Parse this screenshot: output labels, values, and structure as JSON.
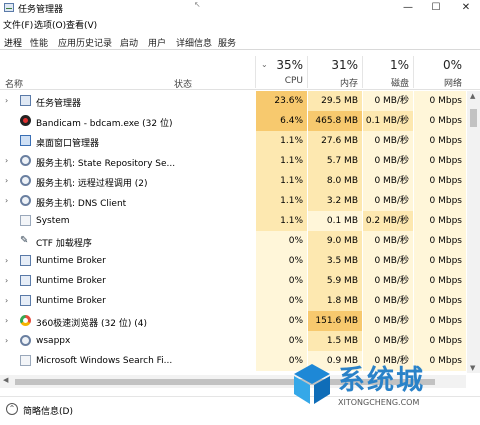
{
  "window": {
    "title": "任务管理器"
  },
  "menu": [
    "文件(F)",
    "选项(O)",
    "查看(V)"
  ],
  "tabs": [
    "进程",
    "性能",
    "应用历史记录",
    "启动",
    "用户",
    "详细信息",
    "服务"
  ],
  "header": {
    "name": "名称",
    "status": "状态",
    "cpu": {
      "percent": "35%",
      "label": "CPU"
    },
    "memory": {
      "percent": "31%",
      "label": "内存"
    },
    "disk": {
      "percent": "1%",
      "label": "磁盘"
    },
    "network": {
      "percent": "0%",
      "label": "网络"
    }
  },
  "colors": {
    "heat_high": "#f7c96e",
    "heat_mid": "#fde8b0",
    "heat_low": "#fff6d9",
    "accent": "#2a82c8"
  },
  "processes": [
    {
      "name": "任务管理器",
      "icon": "task-manager-icon",
      "expand": true,
      "cpu": "23.6%",
      "memory": "29.5 MB",
      "disk": "0 MB/秒",
      "network": "0 Mbps"
    },
    {
      "name": "Bandicam - bdcam.exe (32 位)",
      "icon": "bandicam-icon",
      "expand": false,
      "cpu": "6.4%",
      "memory": "465.8 MB",
      "disk": "0.1 MB/秒",
      "network": "0 Mbps"
    },
    {
      "name": "桌面窗口管理器",
      "icon": "window-icon",
      "expand": false,
      "cpu": "1.1%",
      "memory": "27.6 MB",
      "disk": "0 MB/秒",
      "network": "0 Mbps"
    },
    {
      "name": "服务主机: State Repository Se...",
      "icon": "gear-icon",
      "expand": true,
      "cpu": "1.1%",
      "memory": "5.7 MB",
      "disk": "0 MB/秒",
      "network": "0 Mbps"
    },
    {
      "name": "服务主机: 远程过程调用 (2)",
      "icon": "gear-icon",
      "expand": true,
      "cpu": "1.1%",
      "memory": "8.0 MB",
      "disk": "0 MB/秒",
      "network": "0 Mbps"
    },
    {
      "name": "服务主机: DNS Client",
      "icon": "gear-icon",
      "expand": true,
      "cpu": "1.1%",
      "memory": "3.2 MB",
      "disk": "0 MB/秒",
      "network": "0 Mbps"
    },
    {
      "name": "System",
      "icon": "system-icon",
      "expand": false,
      "cpu": "1.1%",
      "memory": "0.1 MB",
      "disk": "0.2 MB/秒",
      "network": "0 Mbps"
    },
    {
      "name": "CTF 加载程序",
      "icon": "ctf-icon",
      "expand": false,
      "cpu": "0%",
      "memory": "9.0 MB",
      "disk": "0 MB/秒",
      "network": "0 Mbps"
    },
    {
      "name": "Runtime Broker",
      "icon": "runtime-broker-icon",
      "expand": true,
      "cpu": "0%",
      "memory": "3.5 MB",
      "disk": "0 MB/秒",
      "network": "0 Mbps"
    },
    {
      "name": "Runtime Broker",
      "icon": "runtime-broker-icon",
      "expand": true,
      "cpu": "0%",
      "memory": "5.9 MB",
      "disk": "0 MB/秒",
      "network": "0 Mbps"
    },
    {
      "name": "Runtime Broker",
      "icon": "runtime-broker-icon",
      "expand": true,
      "cpu": "0%",
      "memory": "1.8 MB",
      "disk": "0 MB/秒",
      "network": "0 Mbps"
    },
    {
      "name": "360极速浏览器 (32 位) (4)",
      "icon": "360-browser-icon",
      "expand": true,
      "cpu": "0%",
      "memory": "151.6 MB",
      "disk": "0 MB/秒",
      "network": "0 Mbps"
    },
    {
      "name": "wsappx",
      "icon": "gear-icon",
      "expand": true,
      "cpu": "0%",
      "memory": "1.5 MB",
      "disk": "0 MB/秒",
      "network": "0 Mbps"
    },
    {
      "name": "Microsoft Windows Search Fi...",
      "icon": "search-filter-icon",
      "expand": false,
      "cpu": "0%",
      "memory": "0.9 MB",
      "disk": "0 MB/秒",
      "network": "0 Mbps"
    }
  ],
  "footer": {
    "label": "简略信息(D)"
  },
  "watermark": {
    "text": "系统城",
    "sub": "XITONGCHENG.COM"
  }
}
